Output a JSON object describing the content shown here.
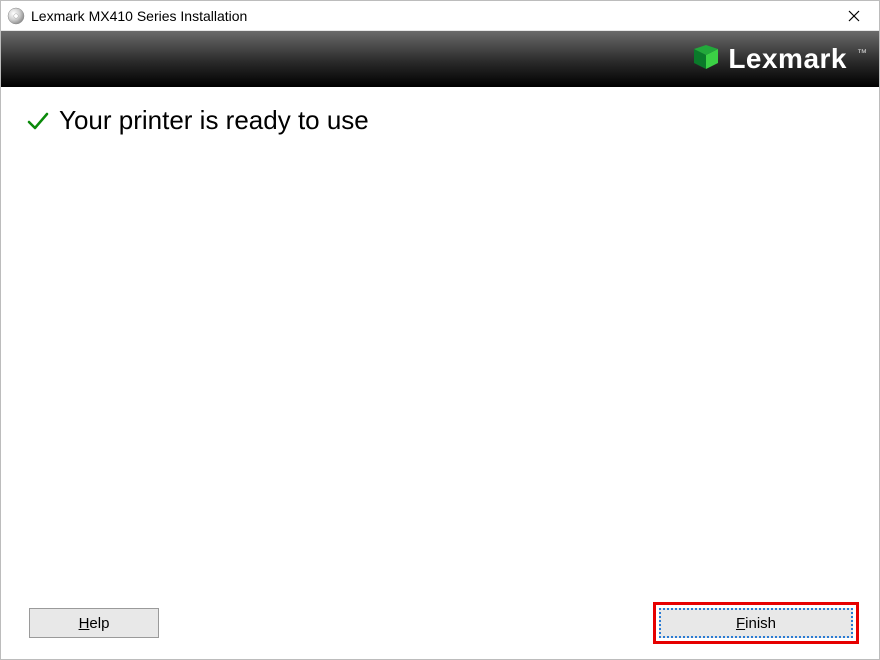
{
  "window": {
    "title": "Lexmark MX410 Series Installation"
  },
  "brand": {
    "name": "Lexmark",
    "tm": "™"
  },
  "status": {
    "message": "Your printer is ready to use"
  },
  "footer": {
    "help_mnemonic": "H",
    "help_rest": "elp",
    "finish_mnemonic": "F",
    "finish_rest": "inish"
  }
}
